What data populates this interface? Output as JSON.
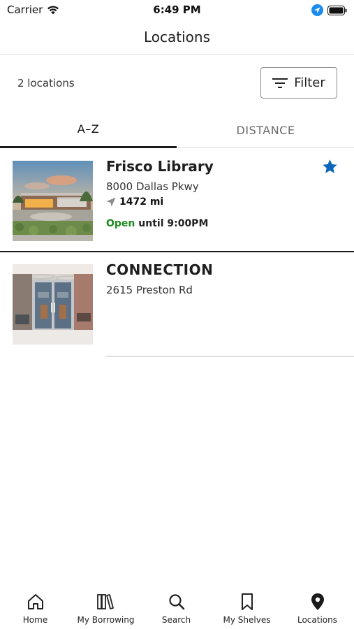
{
  "status_bar": {
    "carrier": "Carrier",
    "time": "6:49 PM"
  },
  "header": {
    "title": "Locations"
  },
  "toolbar": {
    "count_label": "2 locations",
    "filter_label": "Filter"
  },
  "tabs": [
    {
      "label": "A–Z",
      "selected": true
    },
    {
      "label": "DISTANCE",
      "selected": false
    }
  ],
  "locations": [
    {
      "name": "Frisco Library",
      "address": "8000 Dallas Pkwy",
      "distance": "1472 mi",
      "status": "Open",
      "hours_suffix": "until 9:00PM",
      "favorite": true
    },
    {
      "name": "CONNECTION",
      "address": "2615 Preston Rd",
      "favorite": false
    }
  ],
  "bottom_nav": [
    {
      "label": "Home",
      "icon": "home-icon"
    },
    {
      "label": "My Borrowing",
      "icon": "books-icon"
    },
    {
      "label": "Search",
      "icon": "search-icon"
    },
    {
      "label": "My Shelves",
      "icon": "bookmark-icon"
    },
    {
      "label": "Locations",
      "icon": "map-pin-icon",
      "active": true
    }
  ],
  "colors": {
    "accent_blue": "#0a66b8",
    "open_green": "#1e8a1e",
    "location_services_blue": "#1a8cf0"
  }
}
